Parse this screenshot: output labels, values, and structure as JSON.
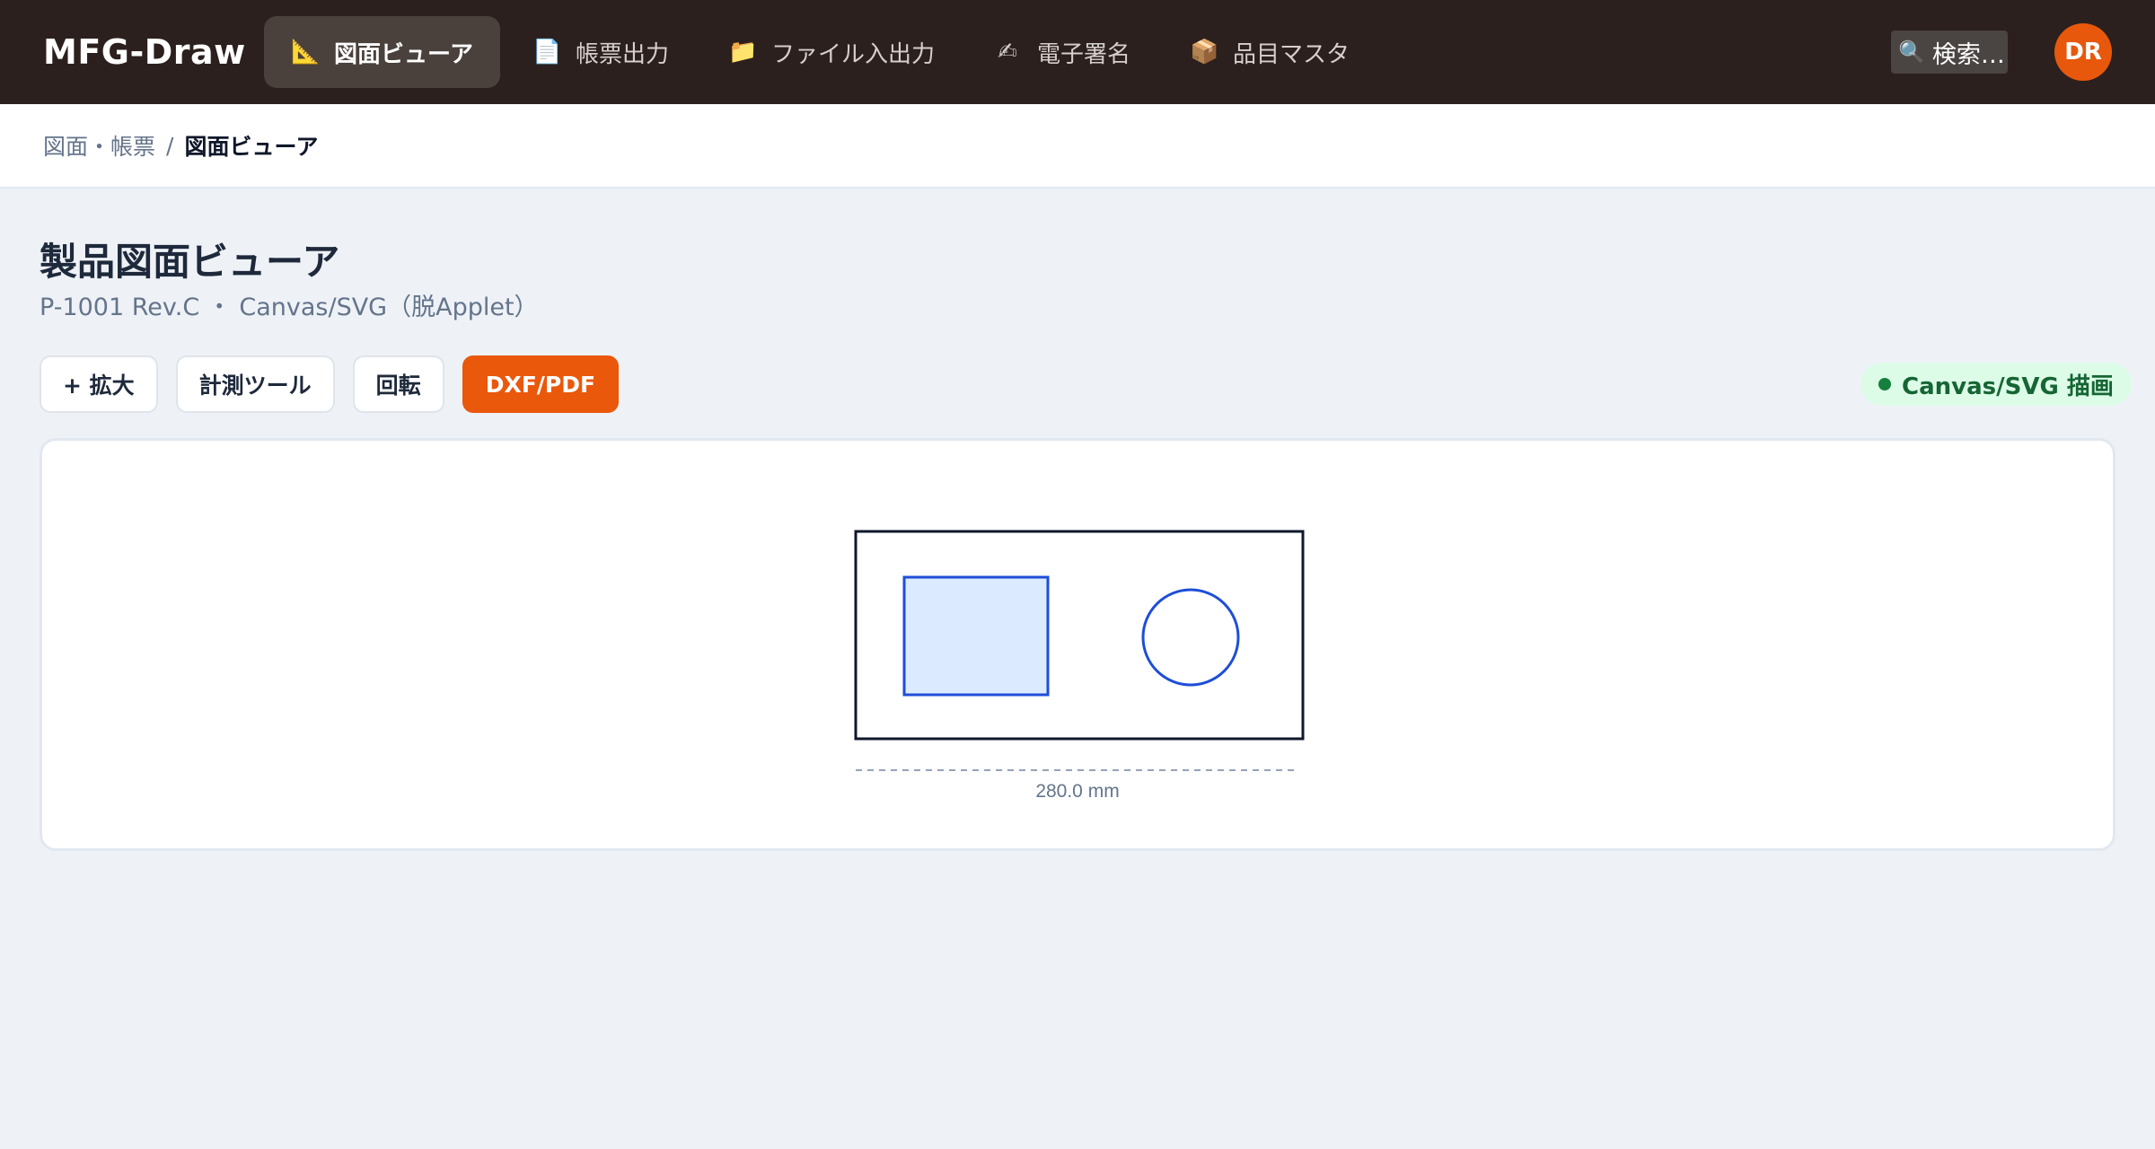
{
  "app": {
    "brand": "MFG-Draw"
  },
  "nav": [
    {
      "icon": "📐",
      "label": "図面ビューア",
      "active": true
    },
    {
      "icon": "📄",
      "label": "帳票出力"
    },
    {
      "icon": "📁",
      "label": "ファイル入出力"
    },
    {
      "icon": "✍",
      "label": "電子署名"
    },
    {
      "icon": "📦",
      "label": "品目マスタ"
    }
  ],
  "search": {
    "icon": "🔍",
    "placeholder": "検索…"
  },
  "user": {
    "initials": "DR"
  },
  "breadcrumb": {
    "parent": "図面・帳票",
    "separator": "/",
    "current": "図面ビューア"
  },
  "page": {
    "title": "製品図面ビューア",
    "subtitle": "P-1001 Rev.C ・ Canvas/SVG（脱Applet）"
  },
  "toolbar": {
    "zoom_label": "+ 拡大",
    "measure_label": "計測ツール",
    "rotate_label": "回転",
    "export_label": "DXF/PDF"
  },
  "status": {
    "label": "Canvas/SVG 描画",
    "color": "#15803d"
  },
  "drawing": {
    "dimension_label": "280.0 mm"
  },
  "colors": {
    "accent": "#ea580c",
    "topbar": "#2b201d",
    "shape_stroke": "#1d4ed8",
    "shape_fill": "#dbeafe"
  }
}
